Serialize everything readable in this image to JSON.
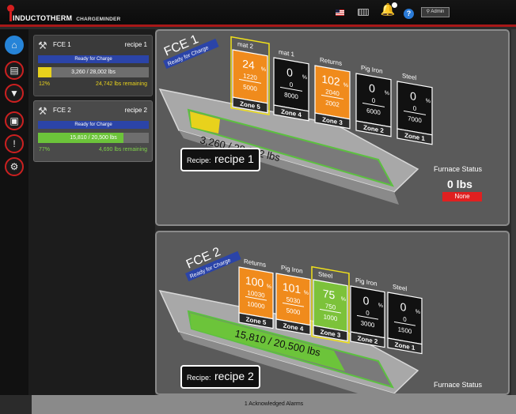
{
  "header": {
    "brand": "INDUCTOTHERM",
    "product": "CHARGEMINDER",
    "user_label": "Admin",
    "icons": [
      "us-flag-icon",
      "keyboard-icon",
      "bell-icon",
      "help-icon",
      "user-icon"
    ]
  },
  "nav": {
    "items": [
      {
        "name": "home",
        "icon": "home-icon",
        "glyph": "⌂"
      },
      {
        "name": "recipes",
        "icon": "document-icon",
        "glyph": "▤"
      },
      {
        "name": "filter",
        "icon": "filter-icon",
        "glyph": "▼"
      },
      {
        "name": "reports",
        "icon": "report-icon",
        "glyph": "▣"
      },
      {
        "name": "alarms",
        "icon": "alarm-icon",
        "glyph": "!"
      },
      {
        "name": "settings",
        "icon": "gear-icon",
        "glyph": "⚙"
      }
    ]
  },
  "furnaces": [
    {
      "name": "FCE 1",
      "recipe": "recipe 1",
      "status": "Ready for Charge",
      "weight": "3,260 / 28,002 lbs",
      "percent_text": "12%",
      "percent": 12,
      "remaining": "24,742 lbs remaining",
      "bar_color": "#e8d21c",
      "text_color": "#e8d21c"
    },
    {
      "name": "FCE 2",
      "recipe": "recipe 2",
      "status": "Ready for Charge",
      "weight": "15,810 / 20,500 lbs",
      "percent_text": "77%",
      "percent": 77,
      "remaining": "4,690 lbs remaining",
      "bar_color": "#6cc43a",
      "text_color": "#7fd24a"
    }
  ],
  "views": [
    {
      "title": "FCE 1",
      "subtitle": "Ready for Charge",
      "weight_label": "3,260 / 28,002 lbs",
      "recipe_label": "Recipe:",
      "recipe_value": "recipe 1",
      "status_label": "Furnace Status",
      "status_value": "0 lbs",
      "status_state": "None",
      "fill_color": "#e8d21c",
      "zones": [
        {
          "zone": "Zone 5",
          "material": "mat 2",
          "percent": "24",
          "actual": "1220",
          "target": "5000",
          "color": "#f08b1c",
          "selected": true
        },
        {
          "zone": "Zone 4",
          "material": "mat 1",
          "percent": "0",
          "actual": "0",
          "target": "8000",
          "color": "#111111",
          "selected": false
        },
        {
          "zone": "Zone 3",
          "material": "Returns",
          "percent": "102",
          "actual": "2040",
          "target": "2002",
          "color": "#f08b1c",
          "selected": false
        },
        {
          "zone": "Zone 2",
          "material": "Pig Iron",
          "percent": "0",
          "actual": "0",
          "target": "6000",
          "color": "#111111",
          "selected": false
        },
        {
          "zone": "Zone 1",
          "material": "Steel",
          "percent": "0",
          "actual": "0",
          "target": "7000",
          "color": "#111111",
          "selected": false
        }
      ]
    },
    {
      "title": "FCE 2",
      "subtitle": "Ready for Charge",
      "weight_label": "15,810 / 20,500 lbs",
      "recipe_label": "Recipe:",
      "recipe_value": "recipe 2",
      "status_label": "Furnace Status",
      "fill_color": "#6cc43a",
      "zones": [
        {
          "zone": "Zone 5",
          "material": "Returns",
          "percent": "100",
          "actual": "10030",
          "target": "10000",
          "color": "#f08b1c",
          "selected": false
        },
        {
          "zone": "Zone 4",
          "material": "Pig Iron",
          "percent": "101",
          "actual": "5030",
          "target": "5000",
          "color": "#f08b1c",
          "selected": false
        },
        {
          "zone": "Zone 3",
          "material": "Steel",
          "percent": "75",
          "actual": "750",
          "target": "1000",
          "color": "#7cc23a",
          "selected": true
        },
        {
          "zone": "Zone 2",
          "material": "Pig Iron",
          "percent": "0",
          "actual": "0",
          "target": "3000",
          "color": "#111111",
          "selected": false
        },
        {
          "zone": "Zone 1",
          "material": "Steel",
          "percent": "0",
          "actual": "0",
          "target": "1500",
          "color": "#111111",
          "selected": false
        }
      ]
    }
  ],
  "footer": {
    "alarms": "1 Acknowledged Alarms"
  }
}
